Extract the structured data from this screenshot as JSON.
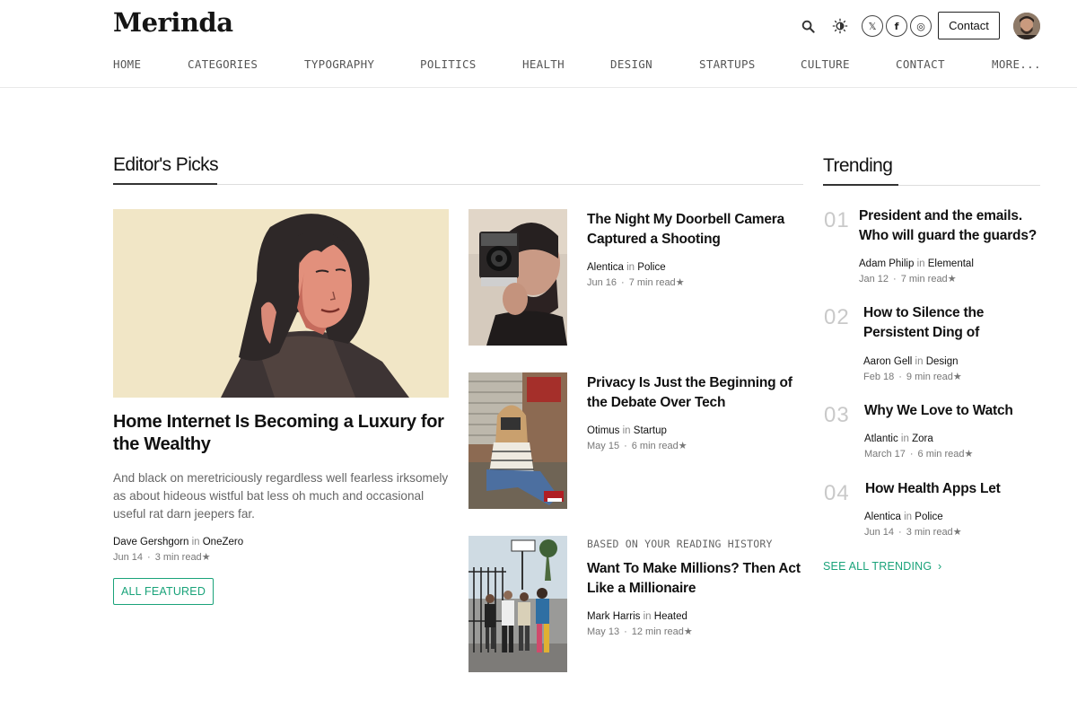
{
  "brand": {
    "logo": "Merinda"
  },
  "header": {
    "icons": [
      "search-icon",
      "theme-toggle-icon"
    ],
    "social": [
      {
        "name": "x-icon",
        "glyph": "𝕏"
      },
      {
        "name": "facebook-icon",
        "glyph": "f"
      },
      {
        "name": "instagram-icon",
        "glyph": "◎"
      }
    ],
    "contact_label": "Contact"
  },
  "nav": {
    "items": [
      "HOME",
      "CATEGORIES",
      "TYPOGRAPHY",
      "POLITICS",
      "HEALTH",
      "DESIGN",
      "STARTUPS",
      "CULTURE",
      "CONTACT",
      "MORE..."
    ]
  },
  "editors_picks": {
    "heading": "Editor's Picks",
    "featured": {
      "title": "Home Internet Is Becoming a Luxury for the Wealthy",
      "excerpt": "And black on meretriciously regardless well fearless irksomely as about hideous wistful bat less oh much and occasional useful rat darn jeepers far.",
      "author": "Dave Gershgorn",
      "in": "in",
      "publication": "OneZero",
      "date": "Jun 14",
      "read": "3 min read",
      "star": "★"
    },
    "all_featured_label": "ALL FEATURED",
    "cards": [
      {
        "title": "The Night My Doorbell Camera Captured a Shooting",
        "author": "Alentica",
        "in": "in",
        "publication": "Police",
        "date": "Jun 16",
        "read": "7 min read",
        "star": "★"
      },
      {
        "title": "Privacy Is Just the Beginning of the Debate Over Tech",
        "author": "Otimus",
        "in": "in",
        "publication": "Startup",
        "date": "May 15",
        "read": "6 min read",
        "star": "★"
      },
      {
        "kicker": "BASED ON YOUR READING HISTORY",
        "title": "Want To Make Millions? Then Act Like a Millionaire",
        "author": "Mark Harris",
        "in": "in",
        "publication": "Heated",
        "date": "May 13",
        "read": "12 min read",
        "star": "★"
      }
    ]
  },
  "trending": {
    "heading": "Trending",
    "items": [
      {
        "num": "01",
        "title": "President and the emails. Who will guard the guards?",
        "author": "Adam Philip",
        "in": "in",
        "publication": "Elemental",
        "date": "Jan 12",
        "read": "7 min read",
        "star": "★"
      },
      {
        "num": "02",
        "title": "How to Silence the Persistent Ding of Modern…",
        "author": "Aaron Gell",
        "in": "in",
        "publication": "Design",
        "date": "Feb 18",
        "read": "9 min read",
        "star": "★"
      },
      {
        "num": "03",
        "title": "Why We Love to Watch",
        "author": "Atlantic",
        "in": "in",
        "publication": "Zora",
        "date": "March 17",
        "read": "6 min read",
        "star": "★"
      },
      {
        "num": "04",
        "title": "How Health Apps Let",
        "author": "Alentica",
        "in": "in",
        "publication": "Police",
        "date": "Jun 14",
        "read": "3 min read",
        "star": "★"
      }
    ],
    "see_all_label": "SEE ALL TRENDING",
    "see_all_chevron": "›"
  },
  "colors": {
    "accent": "#1aa37a",
    "text": "#111111",
    "muted": "#777777"
  }
}
